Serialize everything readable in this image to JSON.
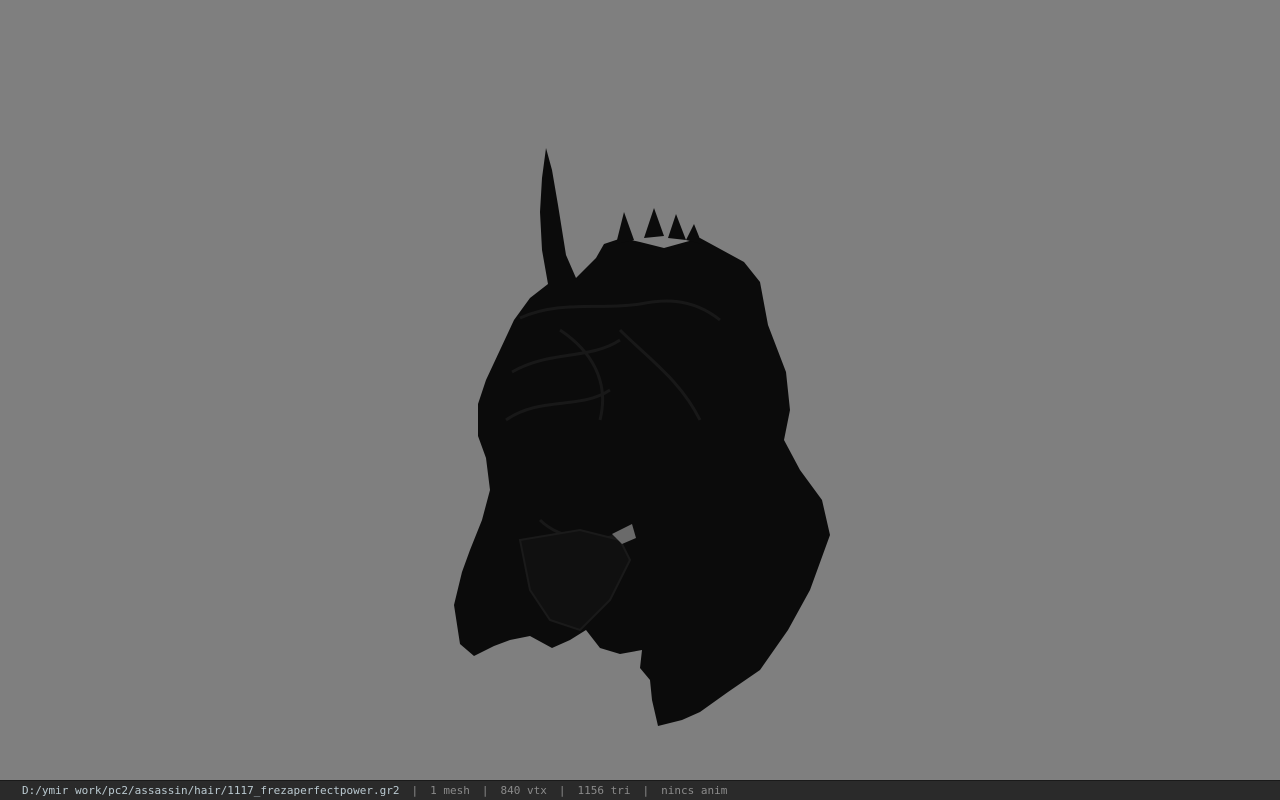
{
  "viewport": {
    "background_color": "#7f7f7f",
    "model_color": "#0b0b0b",
    "model_icon": "helmet-model"
  },
  "status_bar": {
    "file_path": "D:/ymir work/pc2/assassin/hair/1117_frezaperfectpower.gr2",
    "mesh_count": "1 mesh",
    "vertex_count": "840 vtx",
    "triangle_count": "1156 tri",
    "anim_status": "nincs anim",
    "separator": "|",
    "path_color": "#b9c8cf"
  }
}
